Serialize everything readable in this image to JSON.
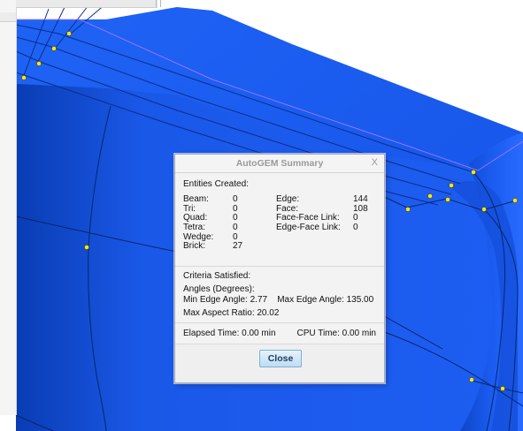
{
  "colors": {
    "mesh_blue": "#1a5cf0",
    "mesh_dark": "#0c3fb8",
    "node_yellow": "#ffe800",
    "dialog_bg": "#efefef"
  },
  "dialog": {
    "title": "AutoGEM Summary",
    "close_x": "X",
    "entities_heading": "Entities Created:",
    "left_labels": [
      "Beam:",
      "Tri:",
      "Quad:",
      "Tetra:",
      "Wedge:",
      "Brick:"
    ],
    "left_values": [
      "0",
      "0",
      "0",
      "0",
      "0",
      "27"
    ],
    "right_labels": [
      "Edge:",
      "Face:",
      "Face-Face Link:",
      "Edge-Face Link:"
    ],
    "right_values": [
      "144",
      "108",
      "0",
      "0"
    ],
    "criteria_heading": "Criteria Satisfied:",
    "angles_heading": "Angles (Degrees):",
    "min_edge_label": "Min Edge Angle:",
    "min_edge_value": "2.77",
    "max_edge_label": "Max Edge Angle:",
    "max_edge_value": "135.00",
    "aspect_label": "Max Aspect Ratio:",
    "aspect_value": "20.02",
    "elapsed_label": "Elapsed Time:",
    "elapsed_value": "0.00 min",
    "cpu_label": "CPU Time:",
    "cpu_value": "0.00 min",
    "close_button": "Close"
  }
}
